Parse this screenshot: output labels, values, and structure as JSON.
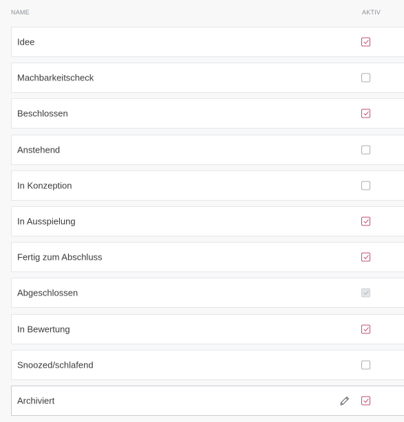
{
  "header": {
    "name_label": "NAME",
    "active_label": "AKTIV"
  },
  "rows": [
    {
      "label": "Idee",
      "active": true
    },
    {
      "label": "Machbarkeitscheck",
      "active": false
    },
    {
      "label": "Beschlossen",
      "active": true
    },
    {
      "label": "Anstehend",
      "active": false
    },
    {
      "label": "In Konzeption",
      "active": false
    },
    {
      "label": "In Ausspielung",
      "active": true
    },
    {
      "label": "Fertig zum Abschluss",
      "active": true
    },
    {
      "label": "Abgeschlossen",
      "active": true,
      "disabled": true
    },
    {
      "label": "In Bewertung",
      "active": true
    },
    {
      "label": "Snoozed/schlafend",
      "active": false
    },
    {
      "label": "Archiviert",
      "active": true,
      "hovered": true,
      "edit_icon": "pencil-icon"
    }
  ],
  "colors": {
    "accent": "#c04a7a",
    "border": "#e4e6e9",
    "background": "#f8f8f9"
  }
}
